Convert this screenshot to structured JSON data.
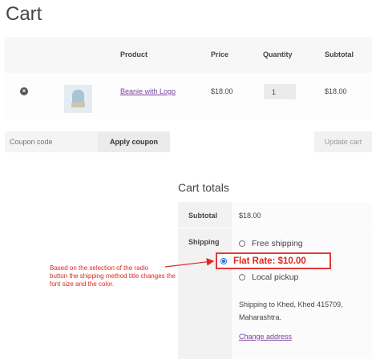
{
  "page": {
    "title": "Cart"
  },
  "cart_table": {
    "headers": {
      "product": "Product",
      "price": "Price",
      "quantity": "Quantity",
      "subtotal": "Subtotal"
    },
    "rows": [
      {
        "remove_icon": "remove-circle-icon",
        "thumbnail": "beanie-image",
        "product": "Beanie with Logo",
        "price": "$18.00",
        "quantity": "1",
        "subtotal": "$18.00"
      }
    ]
  },
  "actions": {
    "coupon_placeholder": "Coupon code",
    "apply_label": "Apply coupon",
    "update_label": "Update cart"
  },
  "totals": {
    "title": "Cart totals",
    "subtotal_label": "Subtotal",
    "subtotal_value": "$18.00",
    "shipping_label": "Shipping",
    "shipping_options": [
      {
        "label": "Free shipping",
        "selected": false
      },
      {
        "label": "Flat Rate: $10.00",
        "selected": true
      },
      {
        "label": "Local pickup",
        "selected": false
      }
    ],
    "shipping_to_line1": "Shipping to Khed, Khed 415709,",
    "shipping_to_line2": "Maharashtra.",
    "change_address": "Change address"
  },
  "annotation": {
    "line1": "Based on the selection of the radio",
    "line2": "button the shipping method title changes the",
    "line3": "font size and the color.",
    "color": "#e0251f"
  },
  "colors": {
    "accent_link": "#7b3fa0",
    "highlight": "#e23a3a",
    "radio_selected": "#1e6fd9"
  }
}
